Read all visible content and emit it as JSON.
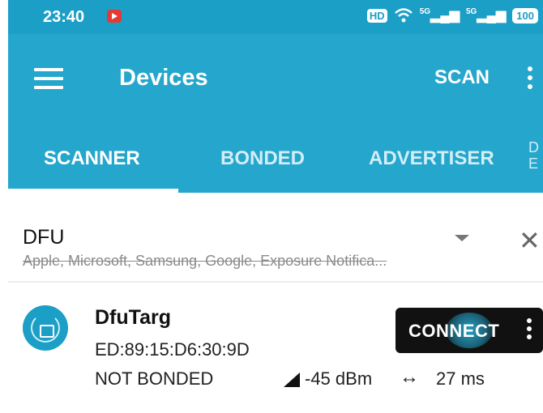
{
  "status_bar": {
    "time": "23:40",
    "icons": [
      "youtube-notification-icon",
      "hd-icon",
      "wifi-icon",
      "signal-5g-icon",
      "signal-5g-icon",
      "battery-icon"
    ],
    "hd_label": "HD",
    "signal_label_1": "5G",
    "signal_label_2": "5G",
    "battery": "100"
  },
  "app_bar": {
    "title": "Devices",
    "scan_label": "SCAN",
    "background_color": "#25a6cc"
  },
  "tabs": [
    {
      "label": "SCANNER",
      "selected": true
    },
    {
      "label": "BONDED",
      "selected": false
    },
    {
      "label": "ADVERTISER",
      "selected": false
    },
    {
      "label": "D E",
      "selected": false
    }
  ],
  "filter": {
    "title": "DFU",
    "subtitle": "Apple, Microsoft, Samsung, Google, Exposure Notifica..."
  },
  "device": {
    "name": "DfuTarg",
    "address": "ED:89:15:D6:30:9D",
    "bond_status": "NOT BONDED",
    "rssi": "-45 dBm",
    "interval": "27 ms",
    "connect_label": "CONNECT"
  }
}
